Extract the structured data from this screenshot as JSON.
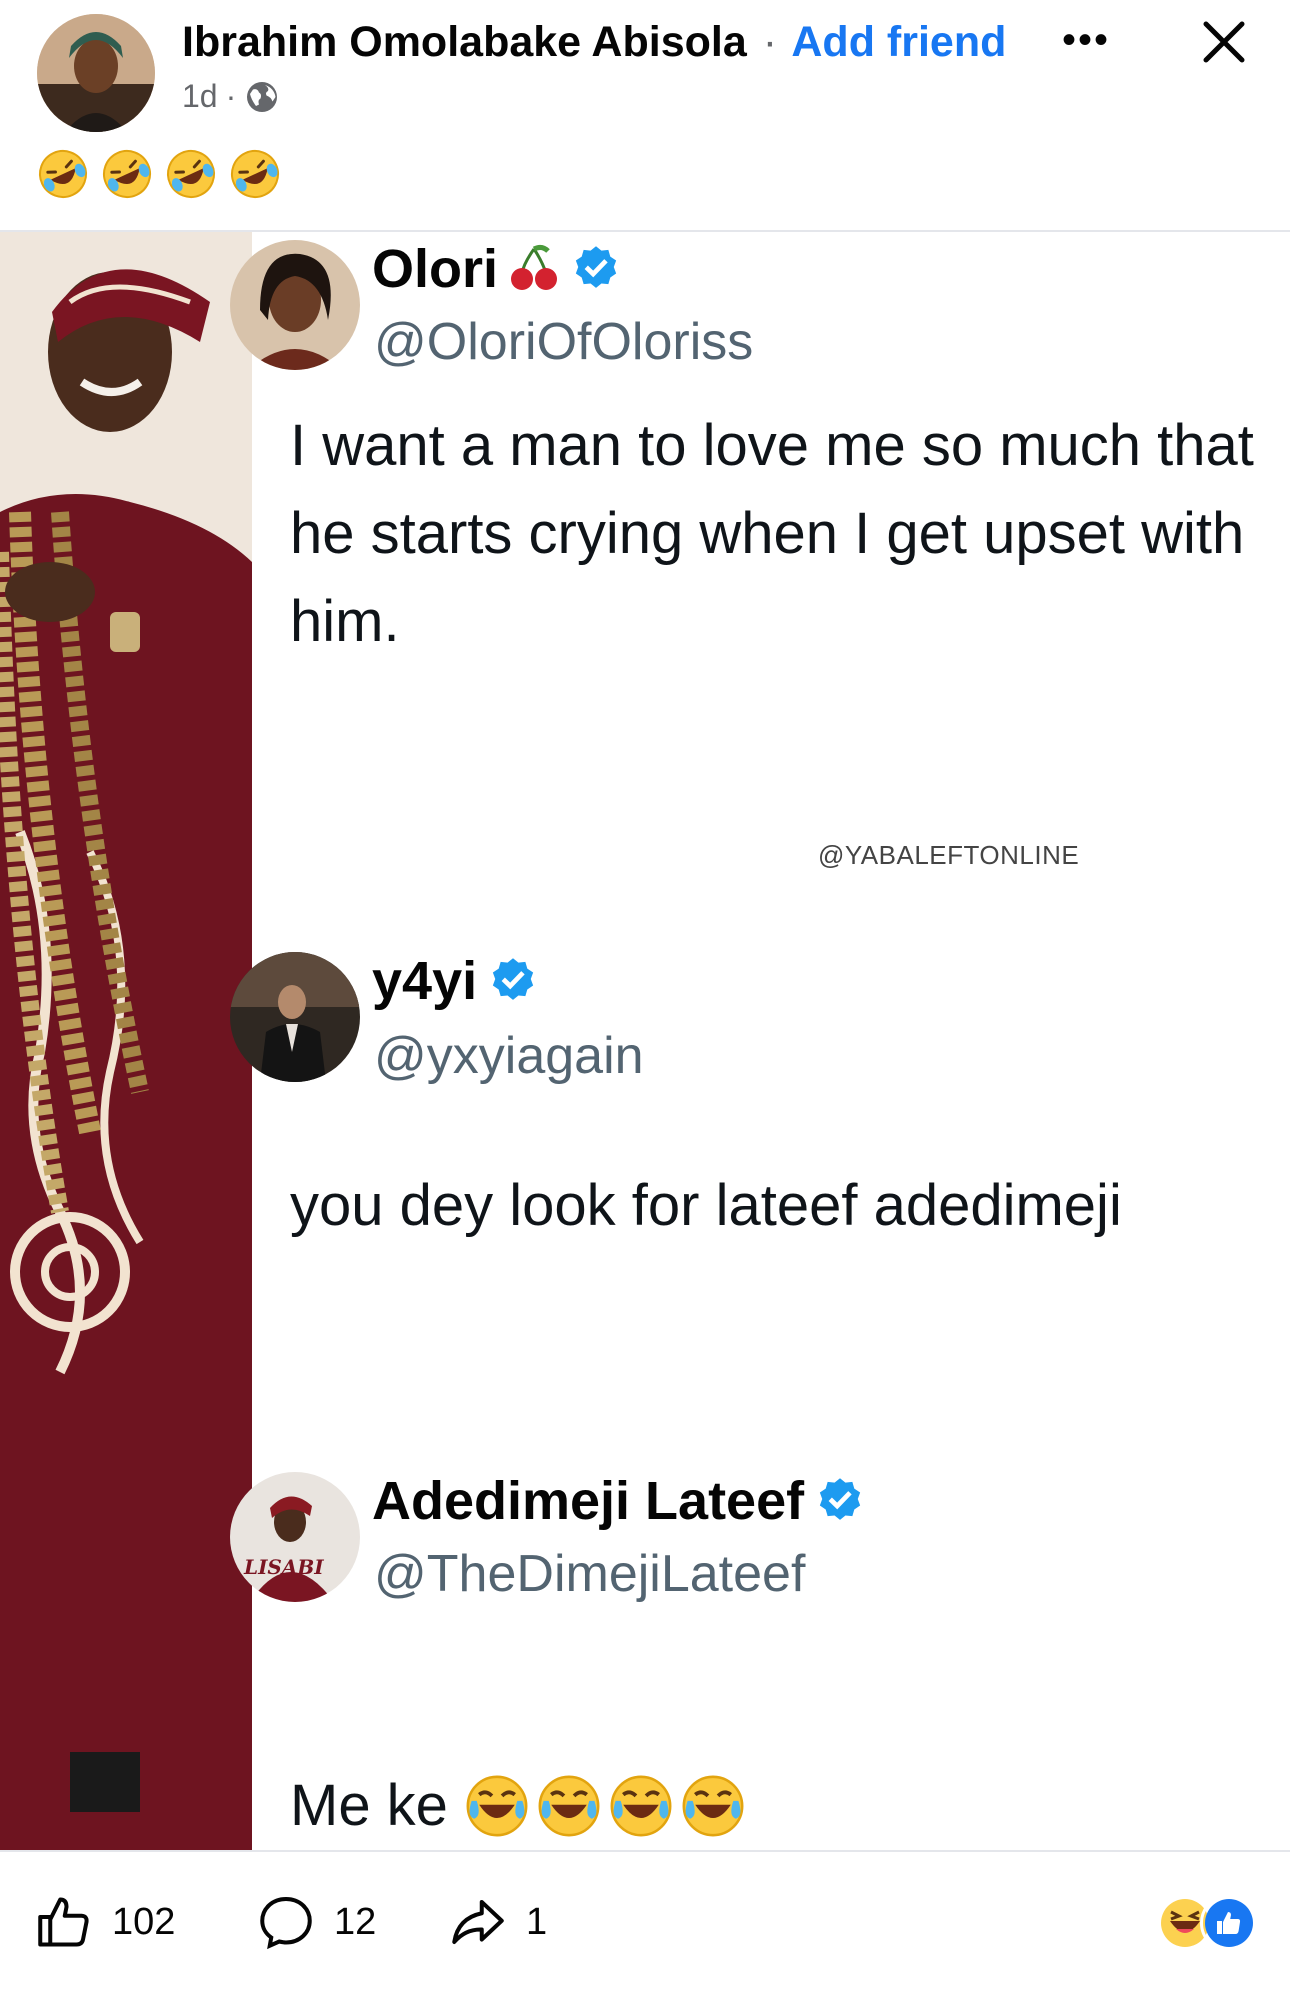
{
  "post": {
    "author": "Ibrahim Omolabake Abisola",
    "separator": "·",
    "add_friend": "Add friend",
    "time": "1d",
    "meta_sep": "·",
    "more": "•••",
    "caption_emojis": [
      "rolling-on-floor-laughing",
      "rolling-on-floor-laughing",
      "rolling-on-floor-laughing",
      "rolling-on-floor-laughing"
    ]
  },
  "tweets": [
    {
      "name": "Olori",
      "name_emoji": "cherries",
      "handle": "@OloriOfOloriss",
      "text": "I want a man to love me so much that he starts crying when I get upset with him."
    },
    {
      "name": "y4yi",
      "handle": "@yxyiagain",
      "text": "you dey look for lateef adedimeji"
    },
    {
      "name": "Adedimeji Lateef",
      "handle": "@TheDimejiLateef",
      "text": "Me ke",
      "text_emojis": [
        "face-with-tears-of-joy",
        "face-with-tears-of-joy",
        "face-with-tears-of-joy",
        "face-with-tears-of-joy"
      ],
      "avatar_text": "LISABI"
    }
  ],
  "watermark": "@YABALEFTONLINE",
  "footer": {
    "likes": "102",
    "comments": "12",
    "shares": "1"
  },
  "colors": {
    "link_blue": "#1877f2",
    "verified_blue": "#1d9bf0",
    "muted": "#65676b"
  }
}
